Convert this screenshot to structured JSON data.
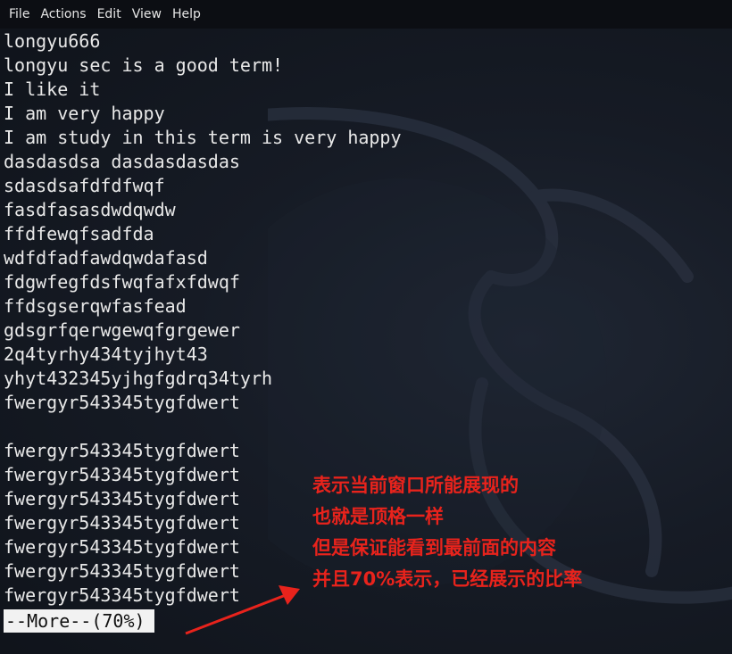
{
  "menubar": {
    "items": [
      "File",
      "Actions",
      "Edit",
      "View",
      "Help"
    ]
  },
  "terminal": {
    "lines": [
      "longyu666",
      "longyu sec is a good term!",
      "I like it",
      "I am very happy",
      "I am study in this term is very happy",
      "dasdasdsa dasdasdasdas",
      "sdasdsafdfdfwqf",
      "fasdfasasdwdqwdw",
      "ffdfewqfsadfda",
      "wdfdfadfawdqwdafasd",
      "fdgwfegfdsfwqfafxfdwqf",
      "ffdsgserqwfasfead",
      "gdsgrfqerwgewqfgrgewer",
      "2q4tyrhy434tyjhyt43",
      "yhyt432345yjhgfgdrq34tyrh",
      "fwergyr543345tygfdwert",
      "",
      "fwergyr543345tygfdwert",
      "fwergyr543345tygfdwert",
      "fwergyr543345tygfdwert",
      "fwergyr543345tygfdwert",
      "fwergyr543345tygfdwert",
      "fwergyr543345tygfdwert",
      "fwergyr543345tygfdwert"
    ],
    "more_prompt": "--More--(70%)"
  },
  "annotation": {
    "lines": [
      "表示当前窗口所能展现的",
      "也就是顶格一样",
      "但是保证能看到最前面的内容",
      "并且70%表示，已经展示的比率"
    ],
    "color": "#e8231c"
  },
  "icons": {
    "watermark": "kali-dragon-icon",
    "arrow": "arrow-icon"
  }
}
